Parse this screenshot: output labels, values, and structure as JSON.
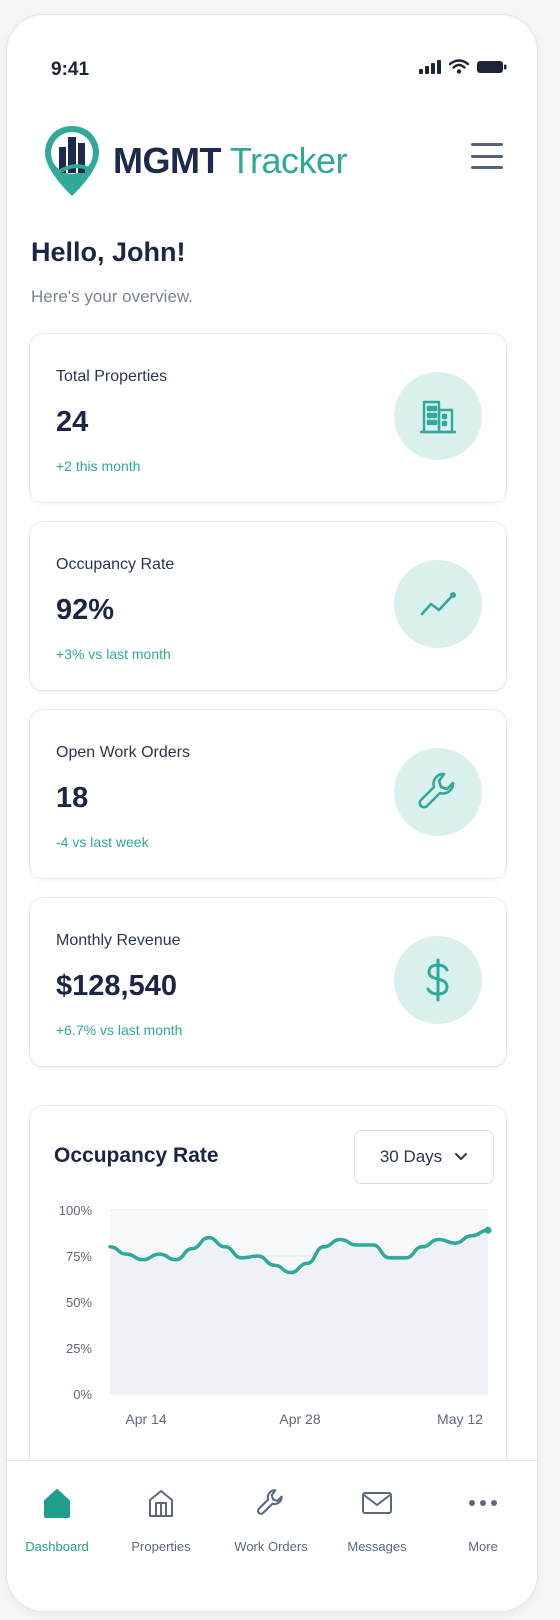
{
  "status_bar": {
    "time": "9:41"
  },
  "header": {
    "brand_bold": "MGMT",
    "brand_light": "Tracker",
    "menu_icon": "hamburger-icon"
  },
  "greeting": {
    "title": "Hello, John!",
    "subtitle": "Here's your overview."
  },
  "stats": [
    {
      "label": "Total Properties",
      "value": "24",
      "change": "+2 this month",
      "icon": "building-icon"
    },
    {
      "label": "Occupancy Rate",
      "value": "92%",
      "change": "+3% vs last month",
      "icon": "trend-up-icon"
    },
    {
      "label": "Open Work Orders",
      "value": "18",
      "change": "-4 vs last week",
      "icon": "wrench-icon"
    },
    {
      "label": "Monthly Revenue",
      "value": "$128,540",
      "change": "+6.7% vs last month",
      "icon": "dollar-icon"
    }
  ],
  "occupancy_chart": {
    "title": "Occupancy Rate",
    "range_label": "30 Days"
  },
  "chart_data": {
    "type": "line",
    "title": "Occupancy Rate",
    "x_tick_labels": [
      "Apr 14",
      "Apr 28",
      "May 12"
    ],
    "y_tick_labels": [
      "100%",
      "75%",
      "50%",
      "25%",
      "0%"
    ],
    "ylim": [
      0,
      100
    ],
    "grid": true,
    "series": [
      {
        "values": [
          80,
          76,
          73,
          76,
          73,
          79,
          85,
          80,
          74,
          75,
          70,
          66,
          71,
          80,
          84,
          81,
          81,
          74,
          74,
          80,
          84,
          82,
          86,
          89
        ]
      }
    ]
  },
  "bottom_nav": {
    "items": [
      {
        "label": "Dashboard",
        "icon": "home-icon",
        "active": true
      },
      {
        "label": "Properties",
        "icon": "building-outline-icon",
        "active": false
      },
      {
        "label": "Work Orders",
        "icon": "wrench-icon",
        "active": false
      },
      {
        "label": "Messages",
        "icon": "mail-icon",
        "active": false
      },
      {
        "label": "More",
        "icon": "more-icon",
        "active": false
      }
    ]
  },
  "colors": {
    "accent": "#2ea99a",
    "navy": "#1d2a4d",
    "icon_bg": "#daf0ed",
    "chart_fill": "#eef1f5"
  }
}
